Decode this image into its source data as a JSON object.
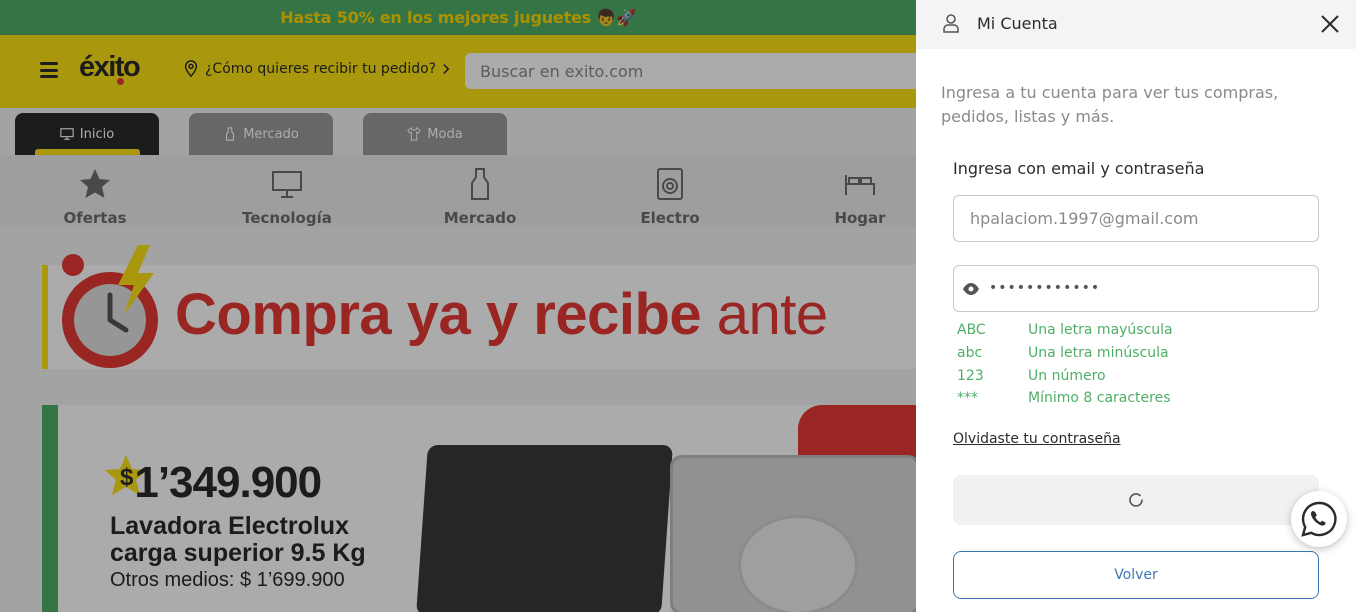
{
  "promo": {
    "text": "Hasta 50% en los mejores juguetes 👦🚀"
  },
  "header": {
    "logo": "éxito",
    "delivery_label": "¿Cómo quieres recibir tu pedido?",
    "search_placeholder": "Buscar en exito.com"
  },
  "tabs": [
    {
      "label": "Inicio",
      "icon": "monitor-icon",
      "active": true
    },
    {
      "label": "Mercado",
      "icon": "bottle-icon",
      "active": false
    },
    {
      "label": "Moda",
      "icon": "shirt-icon",
      "active": false
    }
  ],
  "categories": [
    {
      "label": "Ofertas",
      "icon": "star-icon"
    },
    {
      "label": "Tecnología",
      "icon": "monitor-icon"
    },
    {
      "label": "Mercado",
      "icon": "bottle-icon"
    },
    {
      "label": "Electro",
      "icon": "washer-icon"
    },
    {
      "label": "Hogar",
      "icon": "bed-icon"
    }
  ],
  "banner": {
    "bold": "Compra ya y recibe",
    "thin": "ante"
  },
  "product": {
    "currency": "$",
    "price": "1’349.900",
    "name_line1": "Lavadora Electrolux",
    "name_line2": "carga superior 9.5 Kg",
    "other_price": "Otros medios: $ 1’699.900"
  },
  "panel": {
    "title": "Mi Cuenta",
    "intro": "Ingresa a tu cuenta para ver tus compras, pedidos, listas y más.",
    "form_title": "Ingresa con email y contraseña",
    "email_value": "hpalaciom.1997@gmail.com",
    "password_mask": "••••••••••••",
    "rules": [
      {
        "code": "ABC",
        "text": "Una letra mayúscula"
      },
      {
        "code": "abc",
        "text": "Una letra minúscula"
      },
      {
        "code": "123",
        "text": "Un número"
      },
      {
        "code": "***",
        "text": "Mínimo 8 caracteres"
      }
    ],
    "forgot_label": "Olvidaste tu contraseña",
    "back_label": "Volver"
  },
  "colors": {
    "brand_yellow": "#fce214",
    "success_green": "#4fae67",
    "accent_red": "#e53935",
    "link_blue": "#3c78b4"
  }
}
